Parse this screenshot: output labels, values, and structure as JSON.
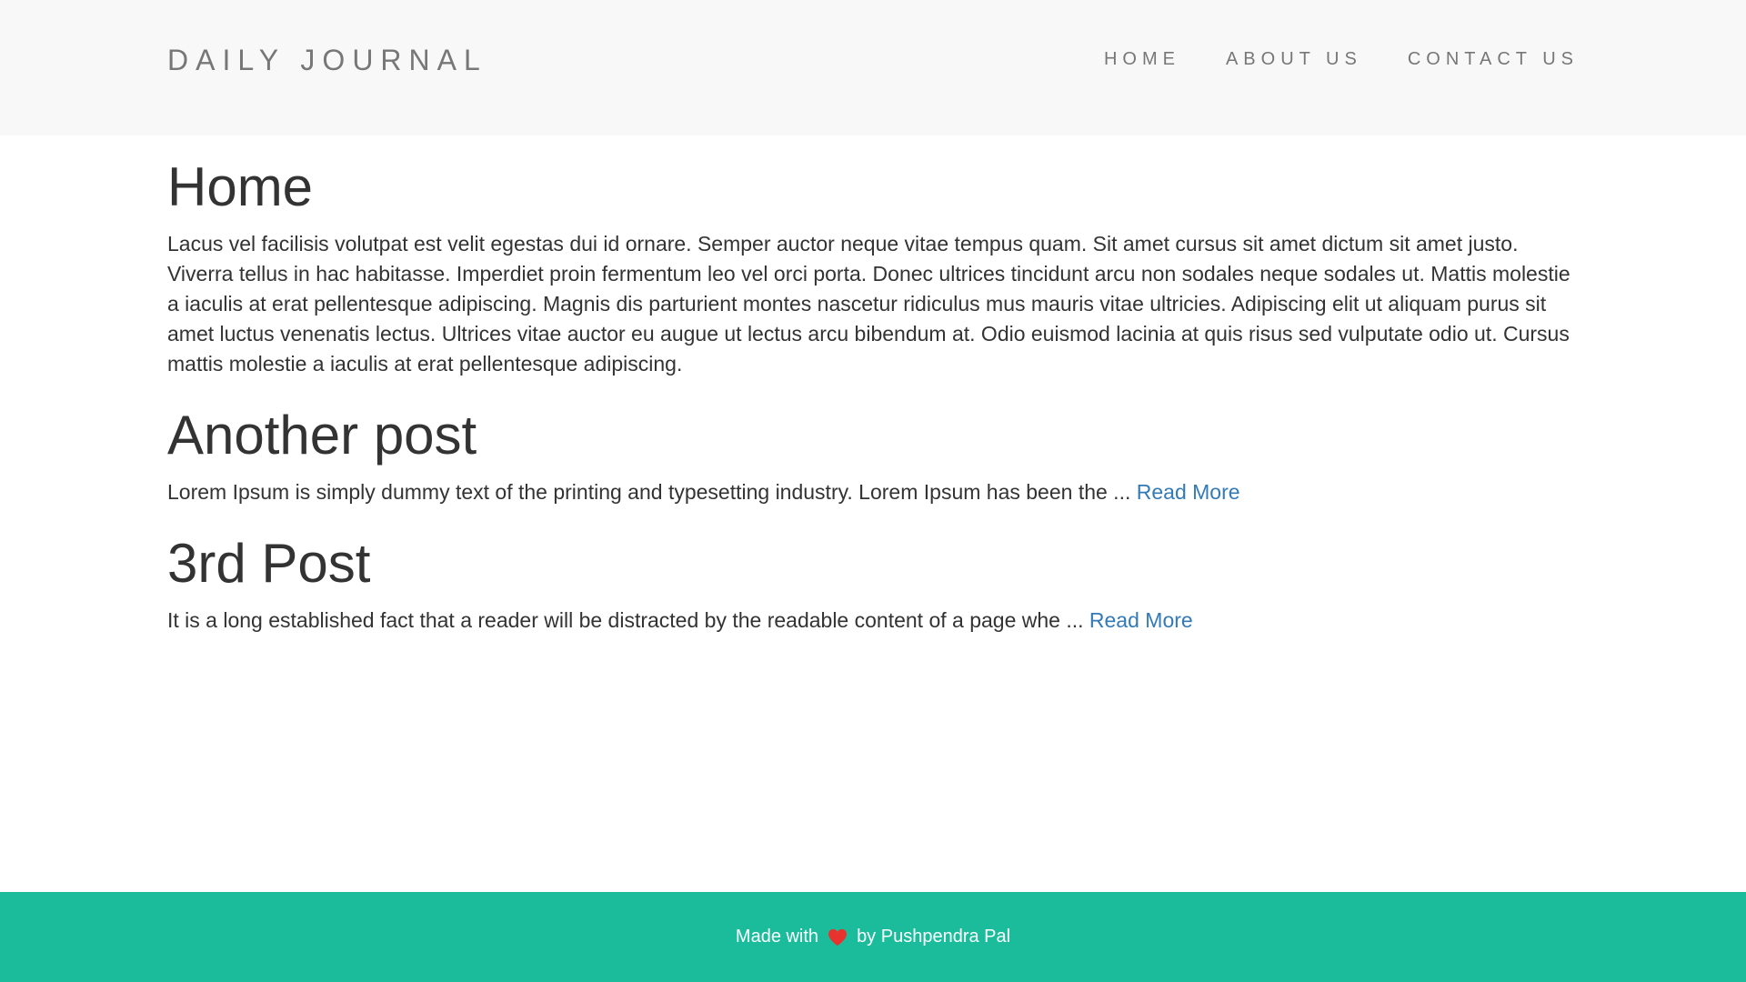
{
  "navbar": {
    "brand": "DAILY JOURNAL",
    "links": [
      {
        "label": "HOME"
      },
      {
        "label": "ABOUT US"
      },
      {
        "label": "CONTACT US"
      }
    ]
  },
  "home": {
    "title": "Home",
    "body": "Lacus vel facilisis volutpat est velit egestas dui id ornare. Semper auctor neque vitae tempus quam. Sit amet cursus sit amet dictum sit amet justo. Viverra tellus in hac habitasse. Imperdiet proin fermentum leo vel orci porta. Donec ultrices tincidunt arcu non sodales neque sodales ut. Mattis molestie a iaculis at erat pellentesque adipiscing. Magnis dis parturient montes nascetur ridiculus mus mauris vitae ultricies. Adipiscing elit ut aliquam purus sit amet luctus venenatis lectus. Ultrices vitae auctor eu augue ut lectus arcu bibendum at. Odio euismod lacinia at quis risus sed vulputate odio ut. Cursus mattis molestie a iaculis at erat pellentesque adipiscing."
  },
  "posts": [
    {
      "title": "Another post",
      "excerpt": "Lorem Ipsum is simply dummy text of the printing and typesetting industry. Lorem Ipsum has been the ...",
      "read_more": "Read More"
    },
    {
      "title": "3rd Post",
      "excerpt": "It is a long established fact that a reader will be distracted by the readable content of a page whe ...",
      "read_more": "Read More"
    }
  ],
  "footer": {
    "prefix": "Made with",
    "icon": "heart-icon",
    "suffix": "by Pushpendra Pal"
  },
  "colors": {
    "navbar_bg": "#f8f8f8",
    "footer_bg": "#1abc9c",
    "link": "#337ab7",
    "heart": "#e8322d"
  }
}
